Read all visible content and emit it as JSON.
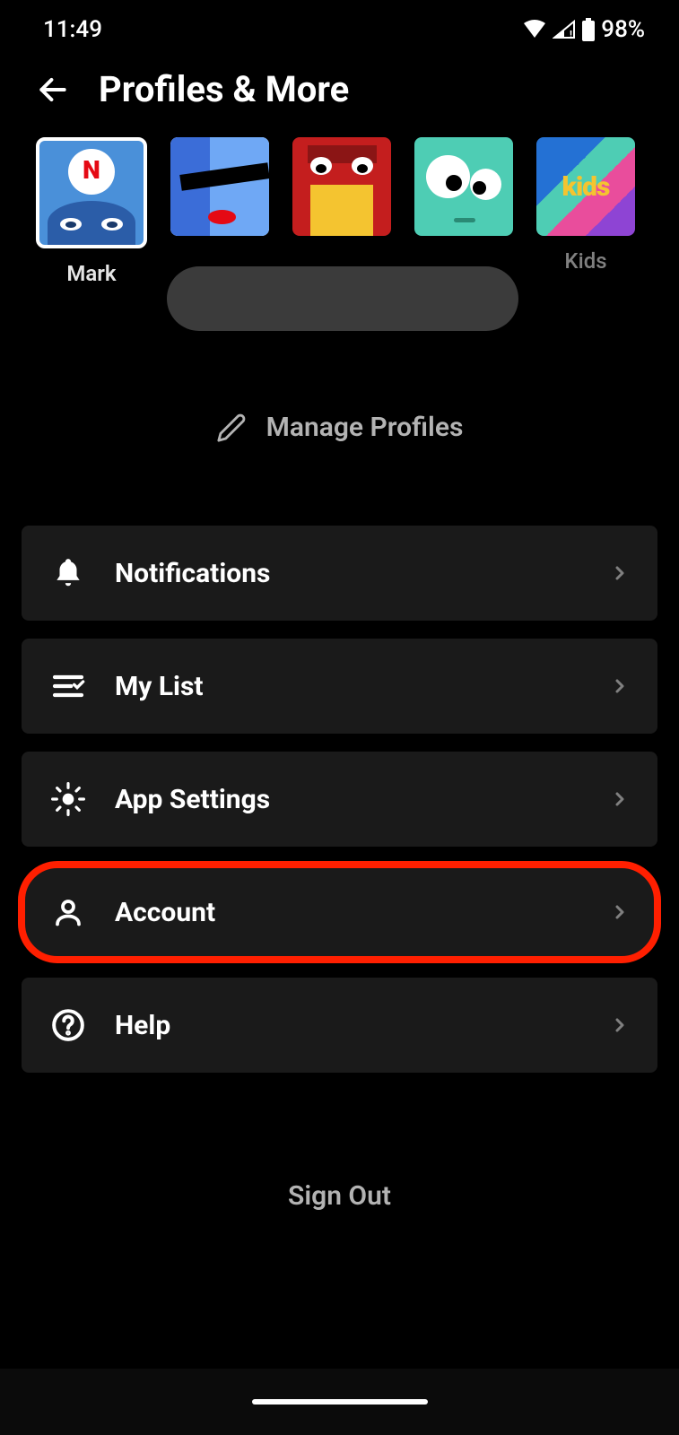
{
  "status": {
    "time": "11:49",
    "battery": "98%"
  },
  "header": {
    "title": "Profiles & More"
  },
  "profiles": [
    {
      "name": "Mark",
      "selected": true
    },
    {
      "name": ""
    },
    {
      "name": ""
    },
    {
      "name": ""
    },
    {
      "name": "Kids",
      "avatar_text": "kids"
    }
  ],
  "manage_profiles_label": "Manage Profiles",
  "menu": [
    {
      "icon": "bell",
      "label": "Notifications",
      "highlighted": false
    },
    {
      "icon": "list",
      "label": "My List",
      "highlighted": false
    },
    {
      "icon": "gear",
      "label": "App Settings",
      "highlighted": false
    },
    {
      "icon": "person",
      "label": "Account",
      "highlighted": true
    },
    {
      "icon": "help",
      "label": "Help",
      "highlighted": false
    }
  ],
  "sign_out_label": "Sign Out"
}
